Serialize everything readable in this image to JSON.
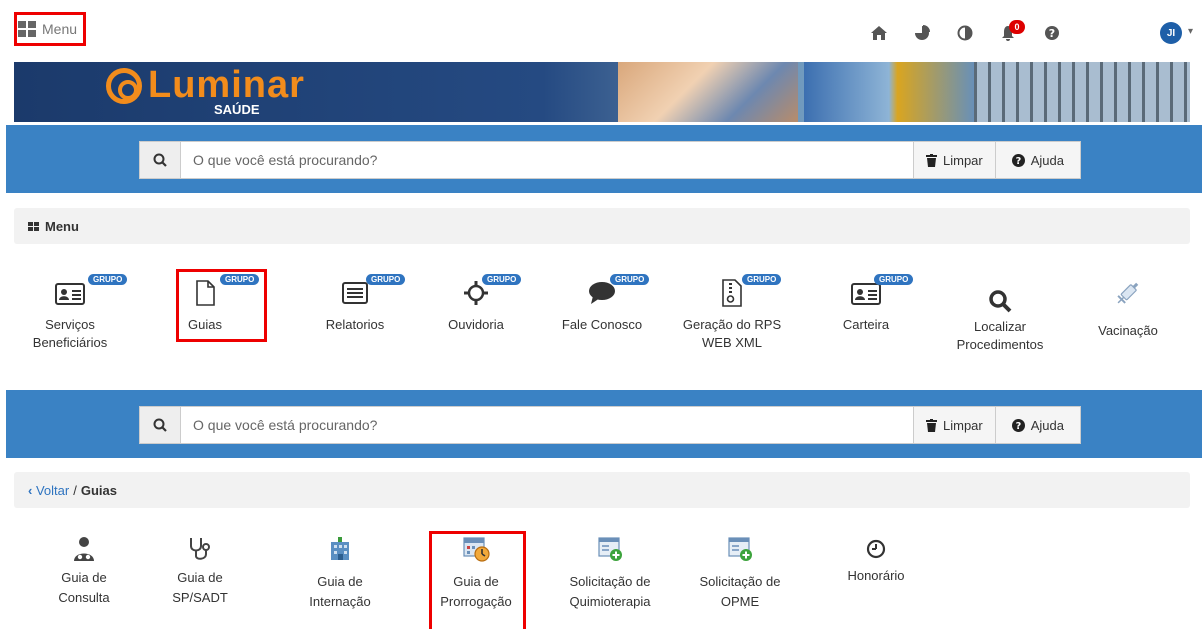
{
  "topbar": {
    "menu_label": "Menu",
    "notification_count": "0",
    "avatar_initials": "JI"
  },
  "banner": {
    "brand": "Luminar",
    "brand_sub": "SAÚDE"
  },
  "search": {
    "placeholder": "O que você está procurando?",
    "clear_label": "Limpar",
    "help_label": "Ajuda"
  },
  "menu": {
    "title": "Menu",
    "badge": "GRUPO",
    "items": [
      {
        "label": "Serviços Beneficiários",
        "icon": "id-card-icon",
        "group": true
      },
      {
        "label": "Guias",
        "icon": "document-icon",
        "group": true
      },
      {
        "label": "Relatorios",
        "icon": "list-icon",
        "group": true
      },
      {
        "label": "Ouvidoria",
        "icon": "crosshair-icon",
        "group": true
      },
      {
        "label": "Fale Conosco",
        "icon": "chat-bubble-icon",
        "group": true
      },
      {
        "label": "Geração do RPS WEB XML",
        "icon": "zip-file-icon",
        "group": true
      },
      {
        "label": "Carteira",
        "icon": "id-card-icon",
        "group": true
      },
      {
        "label": "Localizar Procedimentos",
        "icon": "search-icon",
        "group": false
      },
      {
        "label": "Vacinação",
        "icon": "syringe-icon",
        "group": false
      }
    ]
  },
  "breadcrumb": {
    "back_label": "Voltar",
    "separator": "/",
    "current": "Guias"
  },
  "guias": {
    "items": [
      {
        "label": "Guia de Consulta",
        "icon": "doctor-icon"
      },
      {
        "label": "Guia de SP/SADT",
        "icon": "stethoscope-icon"
      },
      {
        "label": "Guia de Internação",
        "icon": "hospital-icon"
      },
      {
        "label": "Guia de Prorrogação",
        "icon": "calendar-clock-icon"
      },
      {
        "label": "Solicitação de Quimioterapia",
        "icon": "form-add-icon"
      },
      {
        "label": "Solicitação de OPME",
        "icon": "form-add-icon"
      },
      {
        "label": "Honorário",
        "icon": "clock-icon"
      }
    ]
  },
  "colors": {
    "accent_blue": "#3a82c4",
    "badge_blue": "#2f74c0",
    "highlight_red": "#e00000",
    "brand_orange": "#f28c1c"
  }
}
